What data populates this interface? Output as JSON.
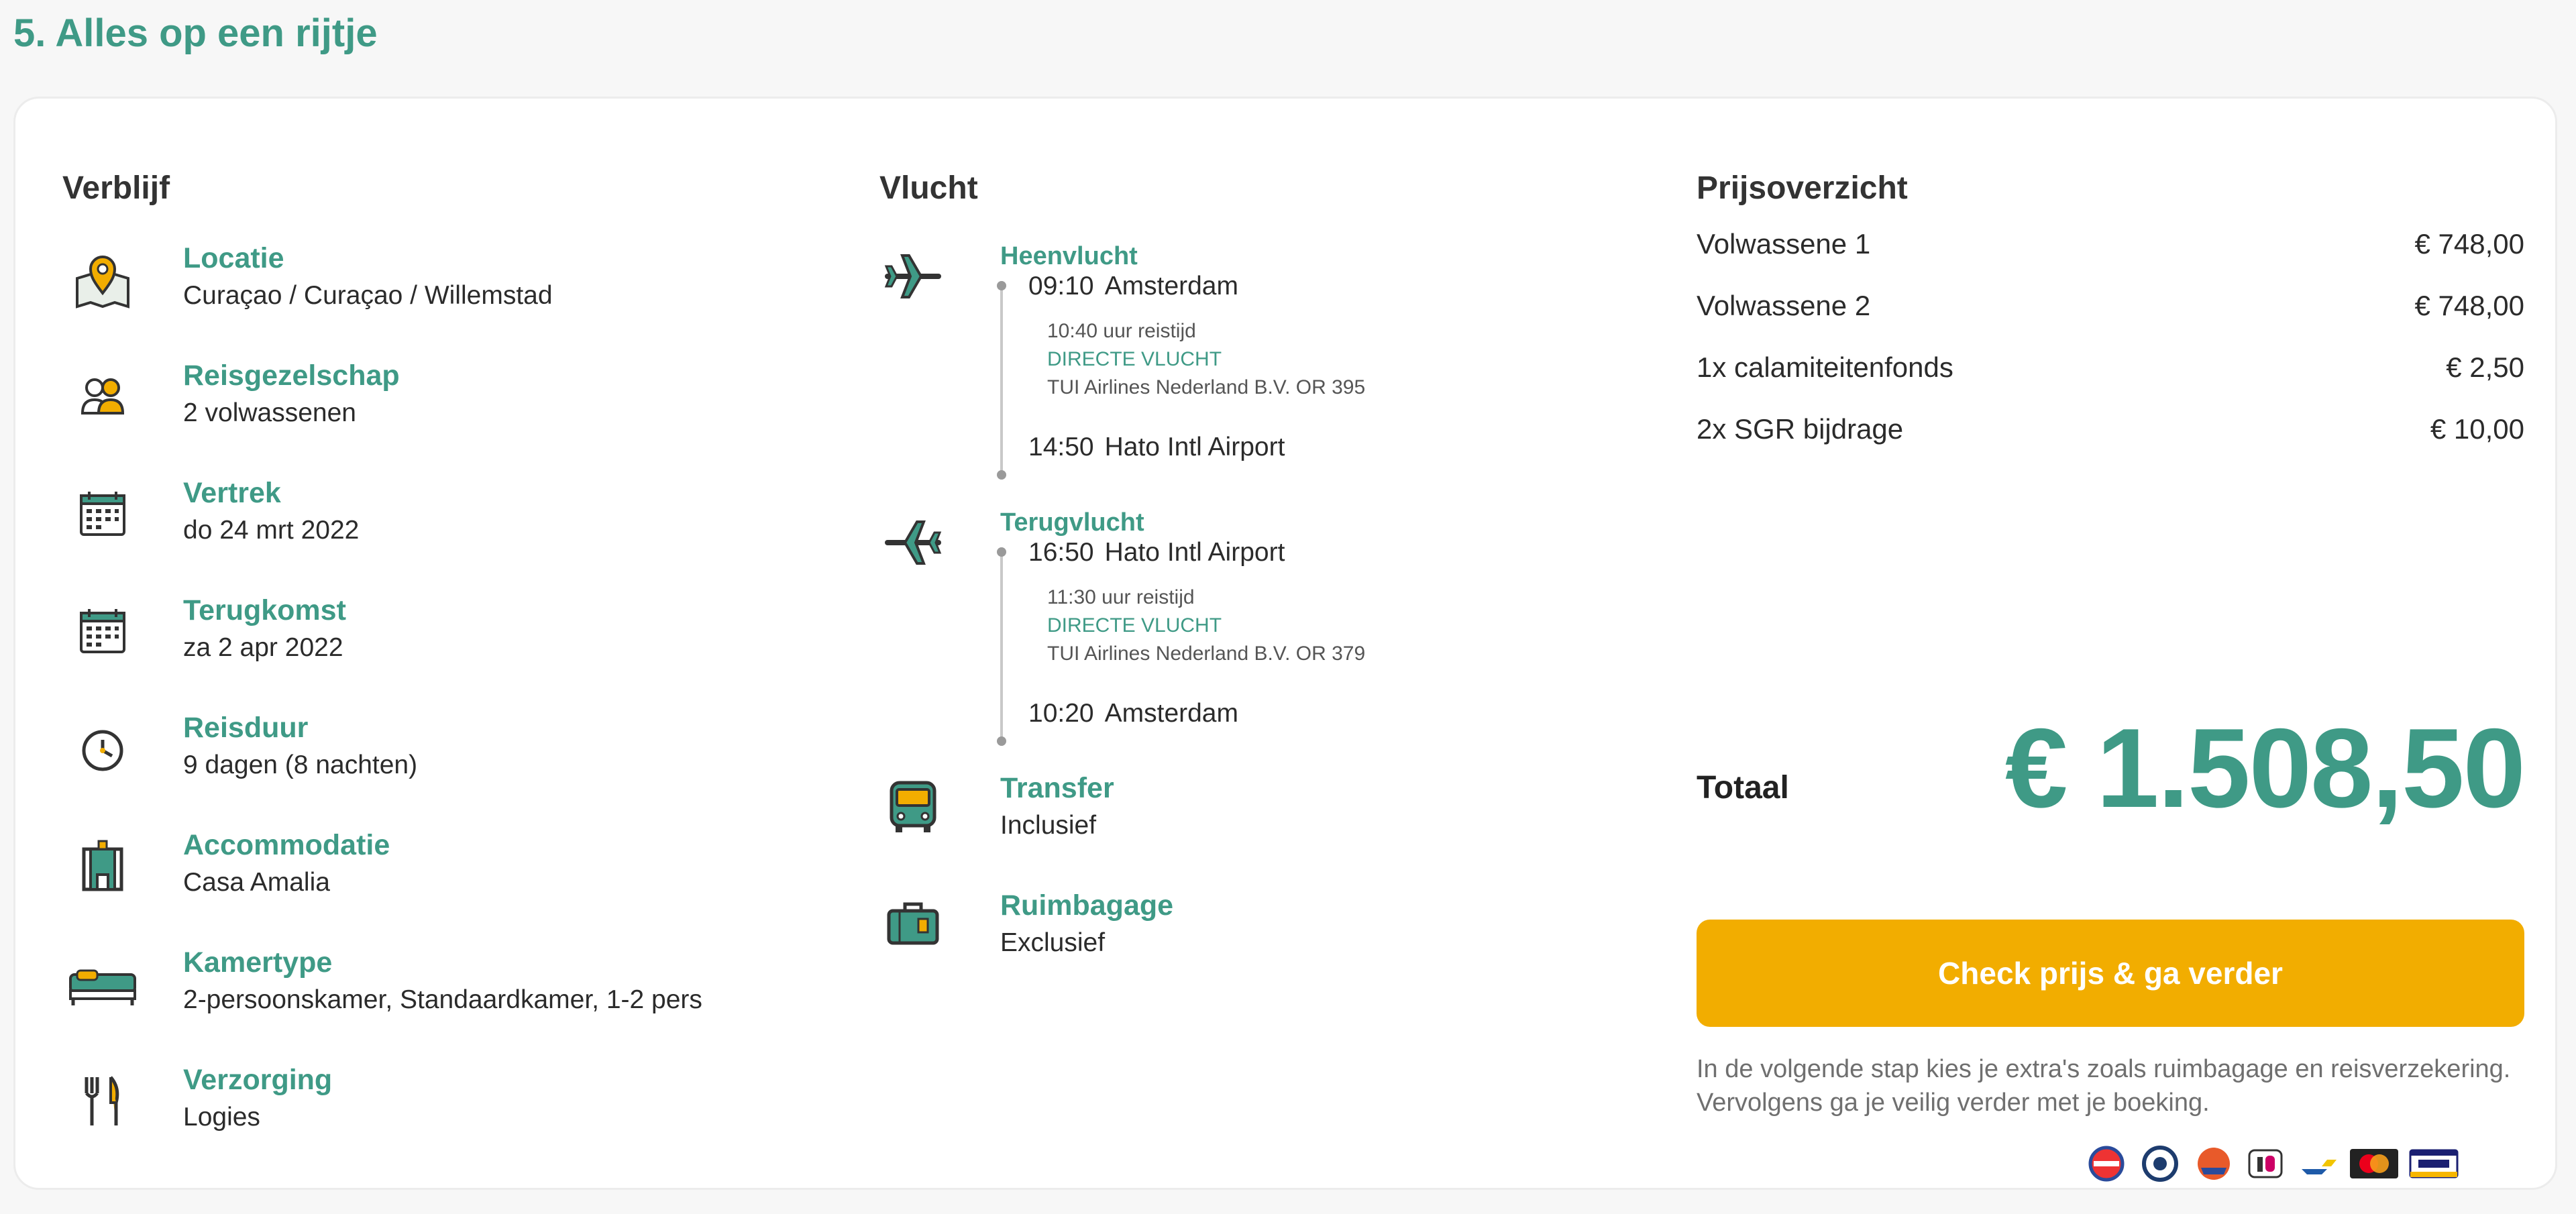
{
  "page": {
    "title": "5. Alles op een rijtje"
  },
  "stay": {
    "title": "Verblijf",
    "items": [
      {
        "label": "Locatie",
        "value": "Curaçao / Curaçao / Willemstad",
        "icon": "map-pin-icon"
      },
      {
        "label": "Reisgezelschap",
        "value": "2 volwassenen",
        "icon": "group-icon"
      },
      {
        "label": "Vertrek",
        "value": "do 24 mrt 2022",
        "icon": "calendar-icon"
      },
      {
        "label": "Terugkomst",
        "value": "za 2 apr 2022",
        "icon": "calendar-icon"
      },
      {
        "label": "Reisduur",
        "value": "9 dagen (8 nachten)",
        "icon": "clock-icon"
      },
      {
        "label": "Accommodatie",
        "value": "Casa Amalia",
        "icon": "building-icon"
      },
      {
        "label": "Kamertype",
        "value": "2-persoonskamer, Standaardkamer, 1-2 pers",
        "icon": "bed-icon"
      },
      {
        "label": "Verzorging",
        "value": "Logies",
        "icon": "cutlery-icon"
      }
    ]
  },
  "flight": {
    "title": "Vlucht",
    "outbound": {
      "label": "Heenvlucht",
      "dep_time": "09:10",
      "dep_place": "Amsterdam",
      "duration": "10:40 uur reistijd",
      "direct": "DIRECTE VLUCHT",
      "airline": "TUI Airlines Nederland B.V. OR 395",
      "arr_time": "14:50",
      "arr_place": "Hato Intl Airport"
    },
    "inbound": {
      "label": "Terugvlucht",
      "dep_time": "16:50",
      "dep_place": "Hato Intl Airport",
      "duration": "11:30 uur reistijd",
      "direct": "DIRECTE VLUCHT",
      "airline": "TUI Airlines Nederland B.V. OR 379",
      "arr_time": "10:20",
      "arr_place": "Amsterdam"
    },
    "transfer": {
      "label": "Transfer",
      "value": "Inclusief"
    },
    "baggage": {
      "label": "Ruimbagage",
      "value": "Exclusief"
    }
  },
  "price": {
    "title": "Prijsoverzicht",
    "rows": [
      {
        "label": "Volwassene 1",
        "value": "€ 748,00"
      },
      {
        "label": "Volwassene 2",
        "value": "€ 748,00"
      },
      {
        "label": "1x calamiteitenfonds",
        "value": "€ 2,50"
      },
      {
        "label": "2x SGR bijdrage",
        "value": "€ 10,00"
      }
    ],
    "total_label": "Totaal",
    "total_value": "€ 1.508,50",
    "cta_label": "Check prijs & ga verder",
    "note": "In de volgende stap kies je extra's zoals ruimbagage en reisverzekering. Vervolgens ga je veilig verder met je boeking."
  },
  "payment_icons": [
    "anvr-logo",
    "calamiteitenfonds-logo",
    "sgr-logo",
    "ideal-logo",
    "bancontact-logo",
    "mastercard-logo",
    "visa-logo"
  ],
  "colors": {
    "accent": "#3f9a86",
    "cta": "#f2ad00",
    "text": "#2b2b2b"
  }
}
